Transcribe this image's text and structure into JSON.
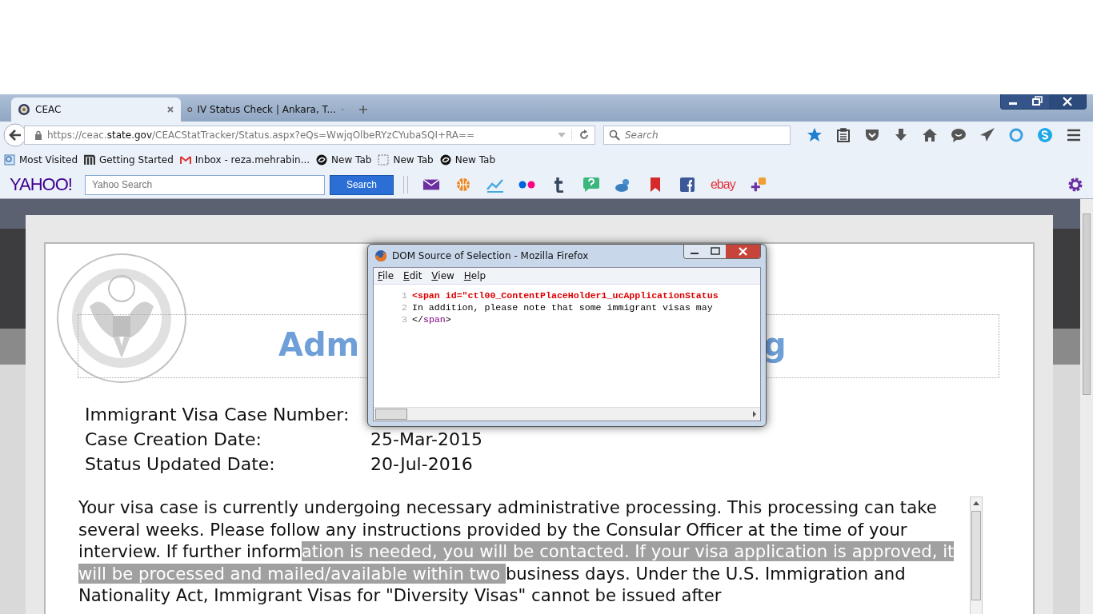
{
  "tabs": [
    {
      "title": "CEAC",
      "selected": true
    },
    {
      "title": "IV Status Check | Ankara, T...",
      "selected": false
    }
  ],
  "address_bar": {
    "url_start": "https://ceac.",
    "url_domain": "state.gov",
    "url_end": "/CEACStatTracker/Status.aspx?eQs=WwjqOlbeRYzCYubaSQI+RA=="
  },
  "search_field": {
    "placeholder": "Search"
  },
  "bookmarks": [
    {
      "label": "Most Visited",
      "kind": "page"
    },
    {
      "label": "Getting Started",
      "kind": "m"
    },
    {
      "label": "Inbox - reza.mehrabin...",
      "kind": "mail"
    },
    {
      "label": "New Tab",
      "kind": "swirl"
    },
    {
      "label": "New Tab",
      "kind": "dashed"
    },
    {
      "label": "New Tab",
      "kind": "swirl"
    }
  ],
  "yahoo_toolbar": {
    "logo": "YAHOO!",
    "search_placeholder": "Yahoo Search",
    "search_button": "Search",
    "ebay": "ebay"
  },
  "heading_visible": {
    "start": "Adm",
    "end": "g"
  },
  "fields": [
    {
      "label": "Immigrant Visa Case Number:"
    },
    {
      "label": "Case Creation Date:",
      "value": "25-Mar-2015"
    },
    {
      "label": "Status Updated Date:",
      "value": "20-Jul-2016"
    }
  ],
  "status_text": {
    "before": "Your visa case is currently undergoing necessary administrative processing. This processing can take several weeks. Please follow any instructions provided by the Consular Officer at the time of your interview. If further inform",
    "selected": "ation is needed, you will be contacted. If your visa application is approved, it will be processed and mailed/available within two ",
    "after": "business days. Under the U.S. Immigration and Nationality Act, Immigrant Visas for \"Diversity Visas\" cannot be issued after"
  },
  "dialog": {
    "title": "DOM Source of Selection - Mozilla Firefox",
    "menu": [
      "File",
      "Edit",
      "View",
      "Help"
    ],
    "lines": [
      {
        "num": "1",
        "parts": [
          {
            "kind": "tag",
            "text": "<span id=\"ctl00_ContentPlaceHolder1_ucApplicationStatus"
          }
        ]
      },
      {
        "num": "2",
        "parts": [
          {
            "kind": "plain",
            "text": "In addition, please note that some immigrant visas may"
          }
        ]
      },
      {
        "num": "3",
        "parts": [
          {
            "kind": "plain",
            "text": "</"
          },
          {
            "kind": "name",
            "text": "span"
          },
          {
            "kind": "plain",
            "text": ">"
          }
        ]
      }
    ]
  }
}
